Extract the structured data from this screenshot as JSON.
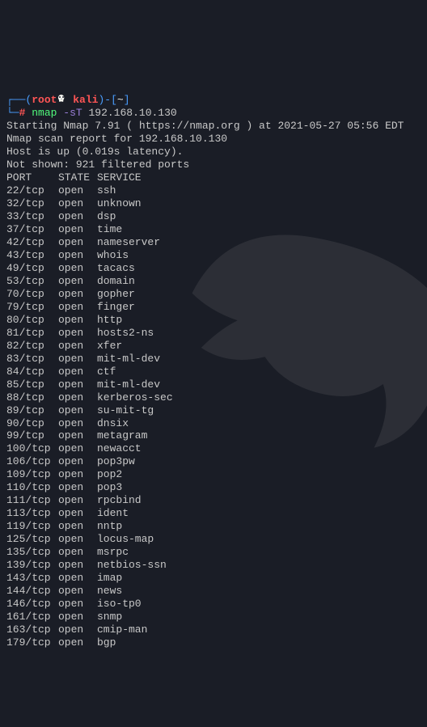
{
  "prompt": {
    "box_open": "┌──",
    "paren_open": "(",
    "user": "root",
    "at": "@",
    "host": "kali",
    "paren_close": ")",
    "dash_open": "-[",
    "path": "~",
    "dash_close": "]",
    "box_bottom": "└─",
    "hash": "#",
    "command": "nmap",
    "flag": "-sT",
    "target": "192.168.10.130"
  },
  "output": {
    "starting": "Starting Nmap 7.91 ( https://nmap.org ) at 2021-05-27 05:56 EDT",
    "report": "Nmap scan report for 192.168.10.130",
    "hostup": "Host is up (0.019s latency).",
    "notshown": "Not shown: 921 filtered ports",
    "header": {
      "port": "PORT",
      "state": "STATE",
      "service": "SERVICE"
    }
  },
  "ports": [
    {
      "port": "22/tcp",
      "state": "open",
      "service": "ssh"
    },
    {
      "port": "32/tcp",
      "state": "open",
      "service": "unknown"
    },
    {
      "port": "33/tcp",
      "state": "open",
      "service": "dsp"
    },
    {
      "port": "37/tcp",
      "state": "open",
      "service": "time"
    },
    {
      "port": "42/tcp",
      "state": "open",
      "service": "nameserver"
    },
    {
      "port": "43/tcp",
      "state": "open",
      "service": "whois"
    },
    {
      "port": "49/tcp",
      "state": "open",
      "service": "tacacs"
    },
    {
      "port": "53/tcp",
      "state": "open",
      "service": "domain"
    },
    {
      "port": "70/tcp",
      "state": "open",
      "service": "gopher"
    },
    {
      "port": "79/tcp",
      "state": "open",
      "service": "finger"
    },
    {
      "port": "80/tcp",
      "state": "open",
      "service": "http"
    },
    {
      "port": "81/tcp",
      "state": "open",
      "service": "hosts2-ns"
    },
    {
      "port": "82/tcp",
      "state": "open",
      "service": "xfer"
    },
    {
      "port": "83/tcp",
      "state": "open",
      "service": "mit-ml-dev"
    },
    {
      "port": "84/tcp",
      "state": "open",
      "service": "ctf"
    },
    {
      "port": "85/tcp",
      "state": "open",
      "service": "mit-ml-dev"
    },
    {
      "port": "88/tcp",
      "state": "open",
      "service": "kerberos-sec"
    },
    {
      "port": "89/tcp",
      "state": "open",
      "service": "su-mit-tg"
    },
    {
      "port": "90/tcp",
      "state": "open",
      "service": "dnsix"
    },
    {
      "port": "99/tcp",
      "state": "open",
      "service": "metagram"
    },
    {
      "port": "100/tcp",
      "state": "open",
      "service": "newacct"
    },
    {
      "port": "106/tcp",
      "state": "open",
      "service": "pop3pw"
    },
    {
      "port": "109/tcp",
      "state": "open",
      "service": "pop2"
    },
    {
      "port": "110/tcp",
      "state": "open",
      "service": "pop3"
    },
    {
      "port": "111/tcp",
      "state": "open",
      "service": "rpcbind"
    },
    {
      "port": "113/tcp",
      "state": "open",
      "service": "ident"
    },
    {
      "port": "119/tcp",
      "state": "open",
      "service": "nntp"
    },
    {
      "port": "125/tcp",
      "state": "open",
      "service": "locus-map"
    },
    {
      "port": "135/tcp",
      "state": "open",
      "service": "msrpc"
    },
    {
      "port": "139/tcp",
      "state": "open",
      "service": "netbios-ssn"
    },
    {
      "port": "143/tcp",
      "state": "open",
      "service": "imap"
    },
    {
      "port": "144/tcp",
      "state": "open",
      "service": "news"
    },
    {
      "port": "146/tcp",
      "state": "open",
      "service": "iso-tp0"
    },
    {
      "port": "161/tcp",
      "state": "open",
      "service": "snmp"
    },
    {
      "port": "163/tcp",
      "state": "open",
      "service": "cmip-man"
    },
    {
      "port": "179/tcp",
      "state": "open",
      "service": "bgp"
    }
  ]
}
